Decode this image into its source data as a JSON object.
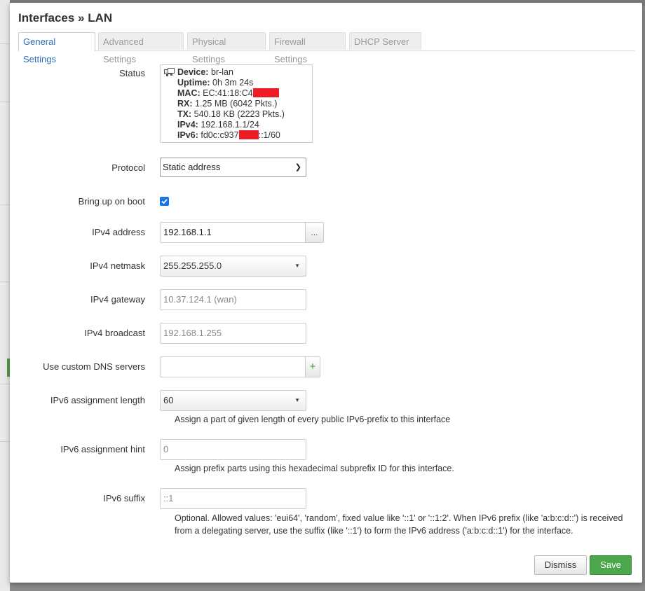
{
  "modal": {
    "title": "Interfaces » LAN"
  },
  "tabs": [
    {
      "label": "General Settings",
      "active": true
    },
    {
      "label": "Advanced Settings",
      "active": false
    },
    {
      "label": "Physical Settings",
      "active": false
    },
    {
      "label": "Firewall Settings",
      "active": false
    },
    {
      "label": "DHCP Server",
      "active": false
    }
  ],
  "status": {
    "label": "Status",
    "device_key": "Device:",
    "device_val": "br-lan",
    "uptime_key": "Uptime:",
    "uptime_val": "0h 3m 24s",
    "mac_key": "MAC:",
    "mac_val": "EC:41:18:C4",
    "rx_key": "RX:",
    "rx_val": "1.25 MB (6042 Pkts.)",
    "tx_key": "TX:",
    "tx_val": "540.18 KB (2223 Pkts.)",
    "ipv4_key": "IPv4:",
    "ipv4_val": "192.168.1.1/24",
    "ipv6_key": "IPv6:",
    "ipv6_val_a": "fd0c:c937",
    "ipv6_val_b": "::1/60"
  },
  "protocol": {
    "label": "Protocol",
    "value": "Static address"
  },
  "boot": {
    "label": "Bring up on boot",
    "checked": true
  },
  "ipv4_address": {
    "label": "IPv4 address",
    "value": "192.168.1.1",
    "addon": "..."
  },
  "ipv4_netmask": {
    "label": "IPv4 netmask",
    "value": "255.255.255.0"
  },
  "ipv4_gateway": {
    "label": "IPv4 gateway",
    "placeholder": "10.37.124.1 (wan)"
  },
  "ipv4_broadcast": {
    "label": "IPv4 broadcast",
    "placeholder": "192.168.1.255"
  },
  "dns": {
    "label": "Use custom DNS servers",
    "value": "",
    "addon": "+"
  },
  "ipv6_length": {
    "label": "IPv6 assignment length",
    "value": "60",
    "hint": "Assign a part of given length of every public IPv6-prefix to this interface"
  },
  "ipv6_hint": {
    "label": "IPv6 assignment hint",
    "placeholder": "0",
    "hint": "Assign prefix parts using this hexadecimal subprefix ID for this interface."
  },
  "ipv6_suffix": {
    "label": "IPv6 suffix",
    "placeholder": "::1",
    "hint": "Optional. Allowed values: 'eui64', 'random', fixed value like '::1' or '::1:2'. When IPv6 prefix (like 'a:b:c:d::') is received from a delegating server, use the suffix (like '::1') to form the IPv6 address ('a:b:c:d::1') for the interface."
  },
  "buttons": {
    "dismiss": "Dismiss",
    "save": "Save"
  },
  "colors": {
    "accent_blue": "#2c6fb7",
    "save_green": "#4ca64c",
    "checkbox_blue": "#1a73e8"
  }
}
